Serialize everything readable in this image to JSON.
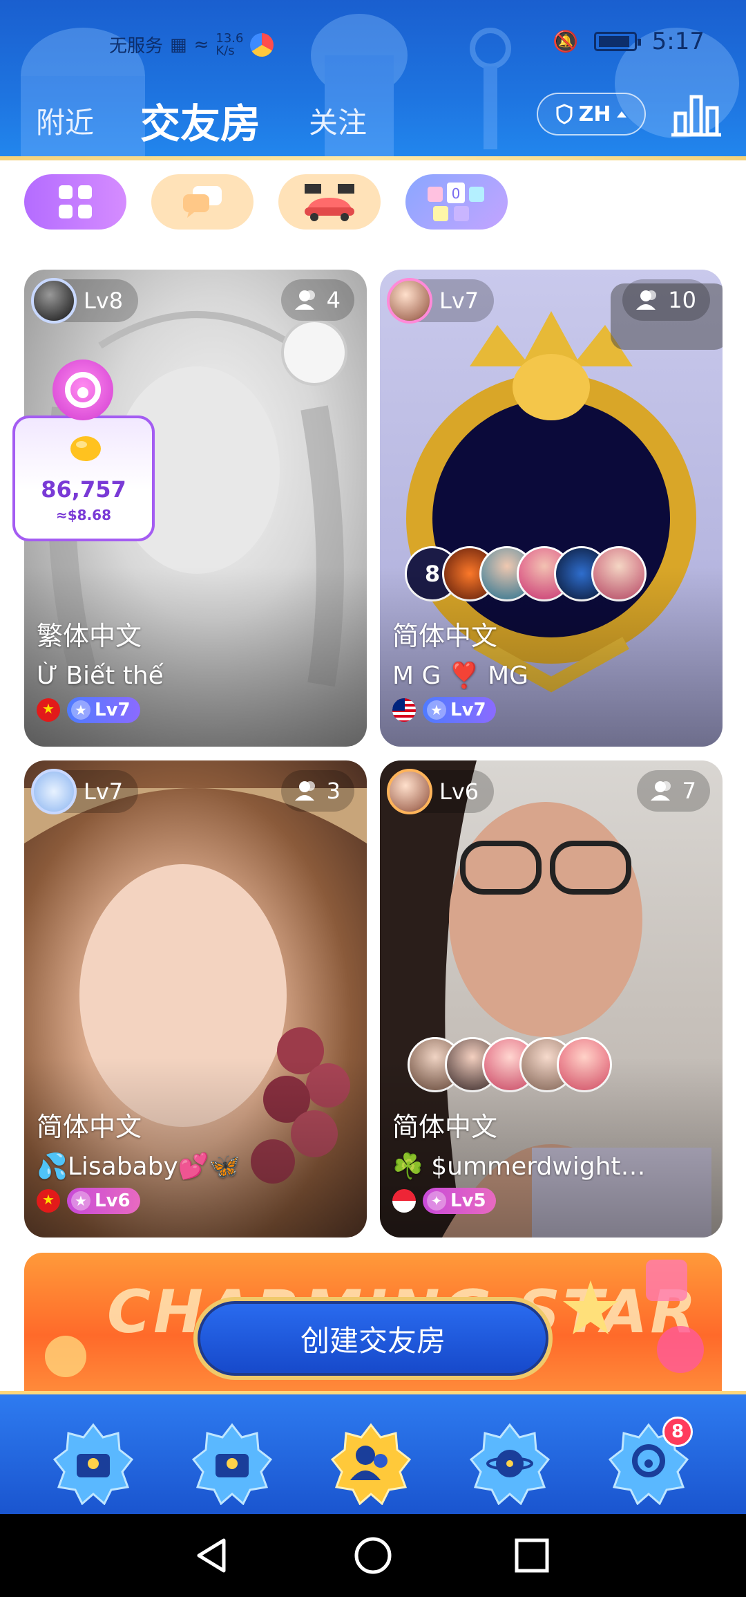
{
  "status_bar": {
    "carrier": "无服务",
    "speed_value": "13.6",
    "speed_unit": "K/s",
    "time": "5:17"
  },
  "nav": {
    "tabs": [
      {
        "label": "附近"
      },
      {
        "label": "交友房"
      },
      {
        "label": "关注"
      }
    ],
    "lang_label": "ZH"
  },
  "rooms": [
    {
      "host_level": "Lv8",
      "member_count": "4",
      "language": "繁体中文",
      "title": "Ừ Biết thế",
      "owner_level": "Lv7"
    },
    {
      "host_level": "Lv7",
      "member_count": "10",
      "language": "简体中文",
      "title": "M G ❣️ MG",
      "owner_level": "Lv7",
      "mic_count_label": "8"
    },
    {
      "host_level": "Lv7",
      "member_count": "3",
      "language": "简体中文",
      "title": "💦Lisababy💕🦋",
      "owner_level": "Lv6"
    },
    {
      "host_level": "Lv6",
      "member_count": "7",
      "language": "简体中文",
      "title": "☘️ $ummerdwight…",
      "owner_level": "Lv5"
    }
  ],
  "gift": {
    "amount": "86,757",
    "usd": "≈$8.68"
  },
  "banner": {
    "text": "CHARMING STAR"
  },
  "create_button": {
    "label": "创建交友房"
  },
  "bottom_nav": {
    "badge_count": "8"
  },
  "colors": {
    "header_blue": "#1e74e0",
    "accent_purple": "#a45cf2",
    "gold": "#f0c96a"
  }
}
